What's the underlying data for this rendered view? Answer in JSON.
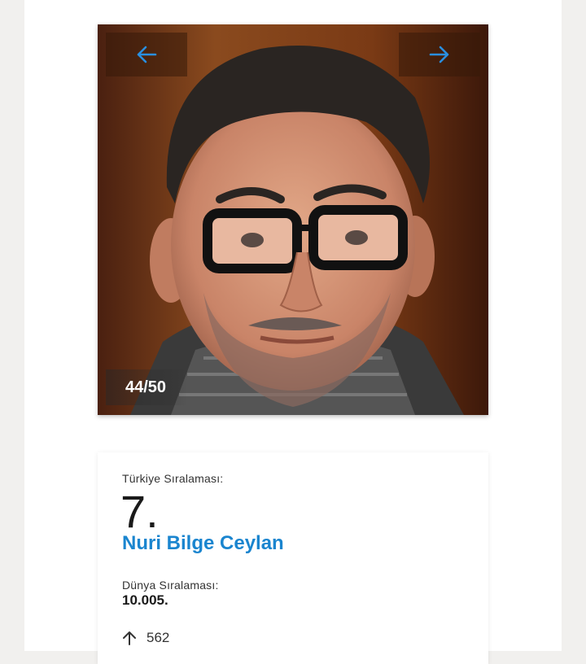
{
  "gallery": {
    "counter": "44/50",
    "prev_icon": "arrow-left-icon",
    "next_icon": "arrow-right-icon",
    "photo_subject": "portrait-photo"
  },
  "profile": {
    "turkey_rank_label": "Türkiye Sıralaması:",
    "turkey_rank_value": "7.",
    "name": "Nuri Bilge Ceylan",
    "world_rank_label": "Dünya Sıralaması:",
    "world_rank_value": "10.005.",
    "change_icon": "arrow-up-icon",
    "change_value": "562"
  },
  "colors": {
    "accent": "#1a85cf",
    "nav_overlay": "#37190a",
    "background": "#f1f0ee"
  }
}
